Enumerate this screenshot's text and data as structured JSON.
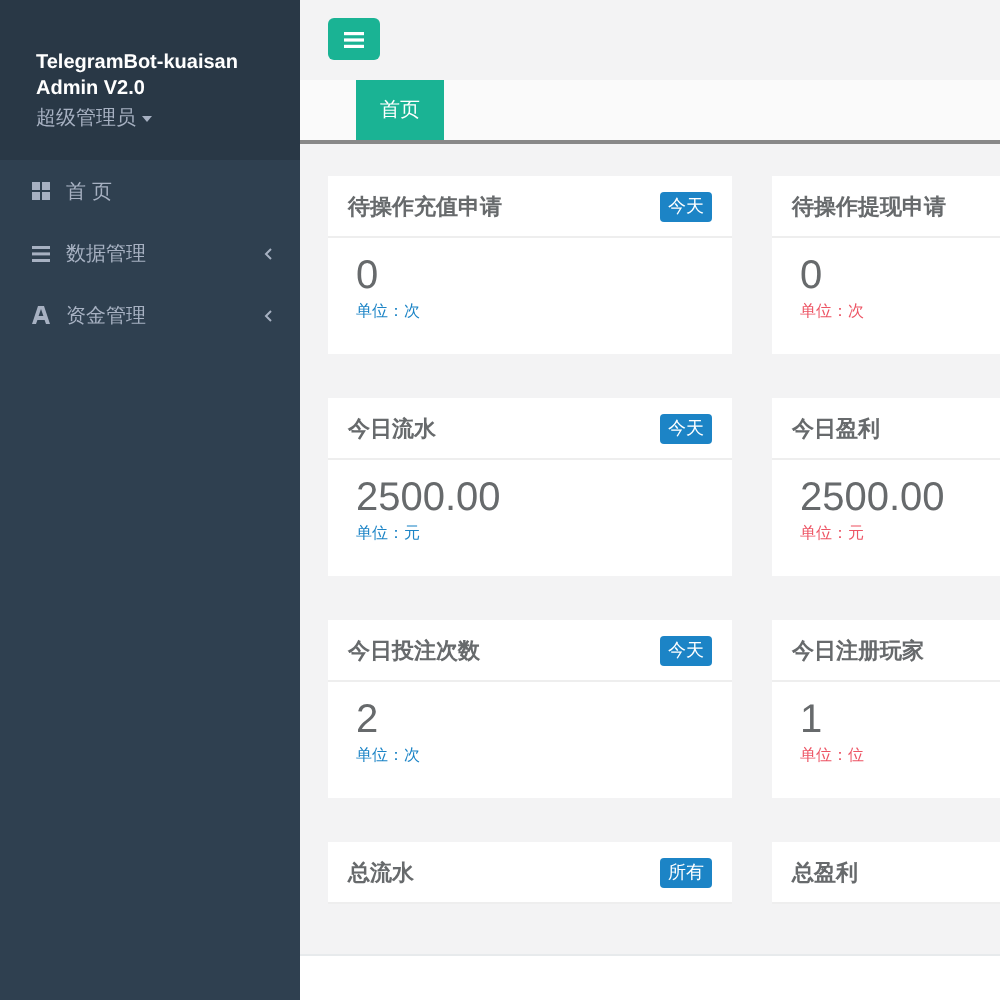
{
  "sidebar": {
    "brand": "TelegramBot-kuaisan",
    "version": "Admin V2.0",
    "role": "超级管理员",
    "items": [
      {
        "kind": "grid",
        "label": "首 页",
        "submenu": false
      },
      {
        "kind": "list",
        "label": "数据管理",
        "submenu": true
      },
      {
        "kind": "font",
        "label": "资金管理",
        "submenu": true
      }
    ]
  },
  "tabs": [
    {
      "label": "首页",
      "selected": true
    }
  ],
  "cards": [
    {
      "title": "待操作充值申请",
      "badge": "今天",
      "value": "0",
      "unit": "单位：次",
      "color": "#1c84c6"
    },
    {
      "title": "待操作提现申请",
      "value": "0",
      "unit": "单位：次",
      "color": "#ed5565"
    },
    {
      "title": "今日流水",
      "badge": "今天",
      "value": "2500.00",
      "unit": "单位：元",
      "color": "#1c84c6"
    },
    {
      "title": "今日盈利",
      "value": "2500.00",
      "unit": "单位：元",
      "color": "#ed5565"
    },
    {
      "title": "今日投注次数",
      "badge": "今天",
      "value": "2",
      "unit": "单位：次",
      "color": "#1c84c6"
    },
    {
      "title": "今日注册玩家",
      "value": "1",
      "unit": "单位：位",
      "color": "#ed5565"
    },
    {
      "title": "总流水",
      "badge": "所有"
    },
    {
      "title": "总盈利"
    }
  ]
}
